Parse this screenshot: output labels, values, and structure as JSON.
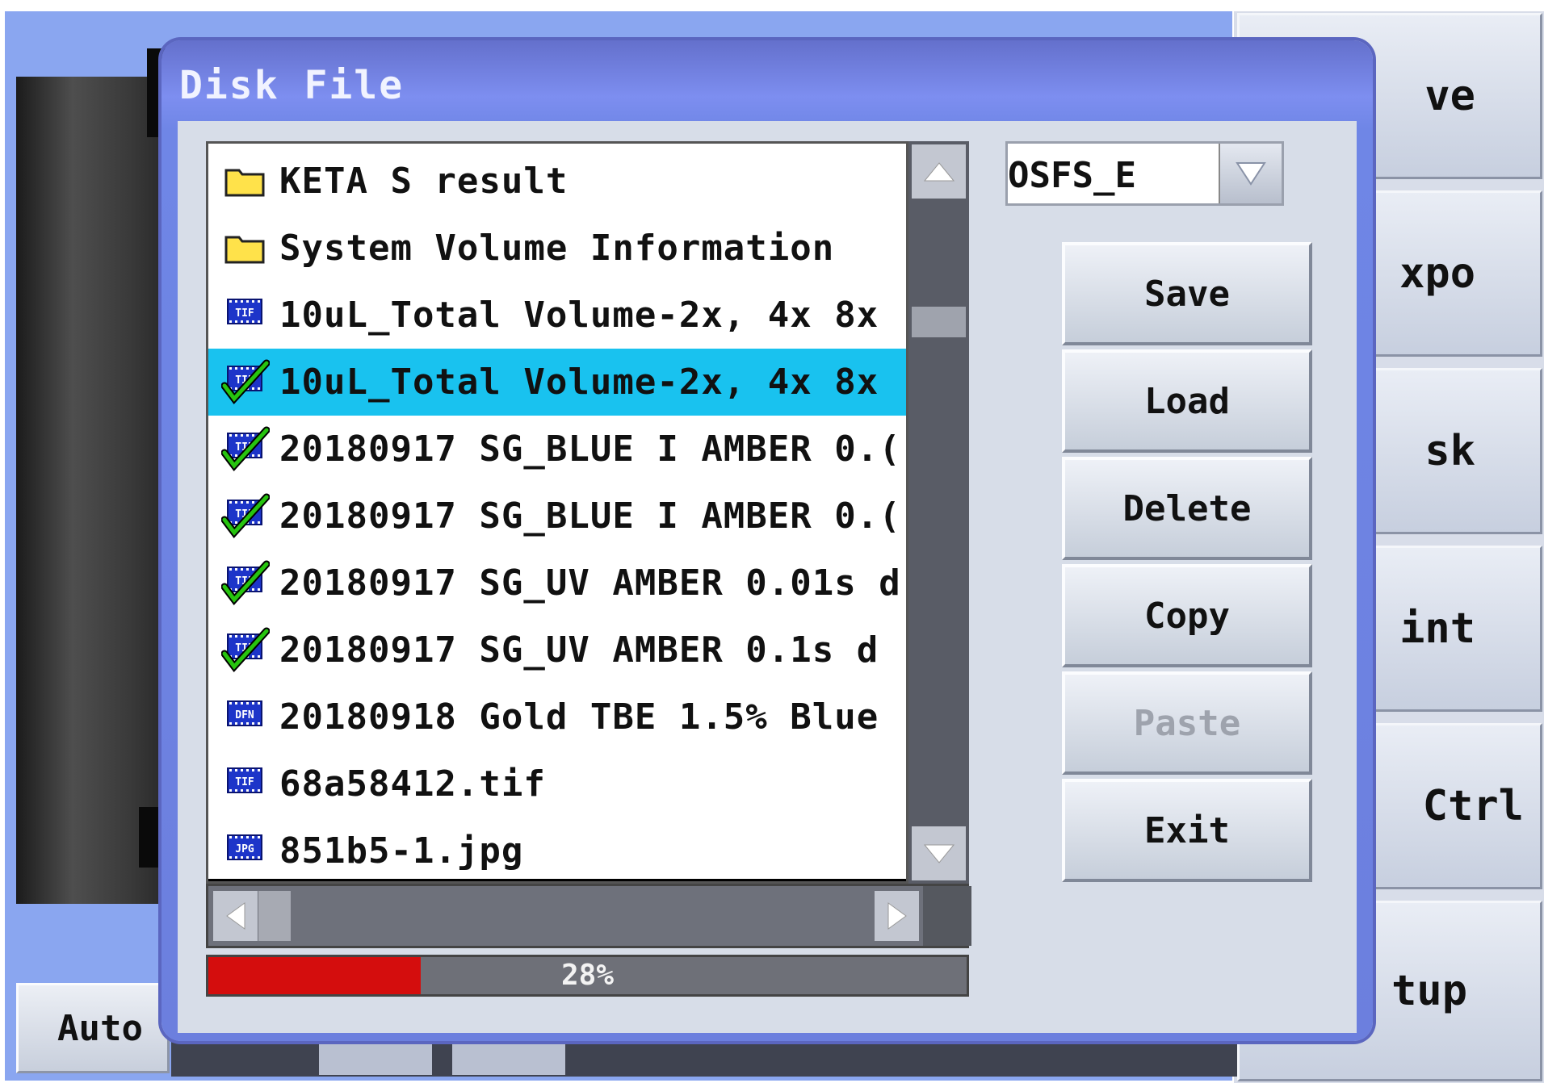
{
  "dialog": {
    "title": "Disk File"
  },
  "background": {
    "side_buttons": [
      "ve",
      "xpo",
      "sk",
      "int",
      "Ctrl",
      "tup"
    ],
    "bottom_button": "Auto"
  },
  "file_list": {
    "items": [
      {
        "type": "folder",
        "label": "KETA S result",
        "checked": false,
        "selected": false,
        "icon": "folder-icon"
      },
      {
        "type": "folder",
        "label": "System Volume Information",
        "checked": false,
        "selected": false,
        "icon": "folder-icon"
      },
      {
        "type": "TIF",
        "label": "10uL_Total Volume-2x, 4x 8x",
        "checked": false,
        "selected": false,
        "icon": "tif-file-icon"
      },
      {
        "type": "TIF",
        "label": "10uL_Total Volume-2x, 4x 8x",
        "checked": true,
        "selected": true,
        "icon": "tif-file-checked-icon"
      },
      {
        "type": "TIF",
        "label": "20180917 SG_BLUE I AMBER 0.(",
        "checked": true,
        "selected": false,
        "icon": "tif-file-checked-icon"
      },
      {
        "type": "TIF",
        "label": "20180917 SG_BLUE I AMBER 0.(",
        "checked": true,
        "selected": false,
        "icon": "tif-file-checked-icon"
      },
      {
        "type": "TIF",
        "label": "20180917 SG_UV AMBER 0.01s d",
        "checked": true,
        "selected": false,
        "icon": "tif-file-checked-icon"
      },
      {
        "type": "TIF",
        "label": "20180917 SG_UV AMBER 0.1s d",
        "checked": true,
        "selected": false,
        "icon": "tif-file-checked-icon"
      },
      {
        "type": "DFN",
        "label": "20180918 Gold TBE 1.5% Blue",
        "checked": false,
        "selected": false,
        "icon": "dfn-file-icon"
      },
      {
        "type": "TIF",
        "label": "68a58412.tif",
        "checked": false,
        "selected": false,
        "icon": "tif-file-icon"
      },
      {
        "type": "JPG",
        "label": "851b5-1.jpg",
        "checked": false,
        "selected": false,
        "icon": "jpg-file-icon"
      }
    ]
  },
  "drive": {
    "value": "OSFS_E"
  },
  "actions": {
    "save": "Save",
    "load": "Load",
    "delete": "Delete",
    "copy": "Copy",
    "paste": "Paste",
    "exit": "Exit"
  },
  "progress": {
    "value": 0.28,
    "label": "28%"
  },
  "colors": {
    "selection": "#19c2ef",
    "progress_fill": "#d40d0d",
    "title_bar": "#6c7fde"
  }
}
